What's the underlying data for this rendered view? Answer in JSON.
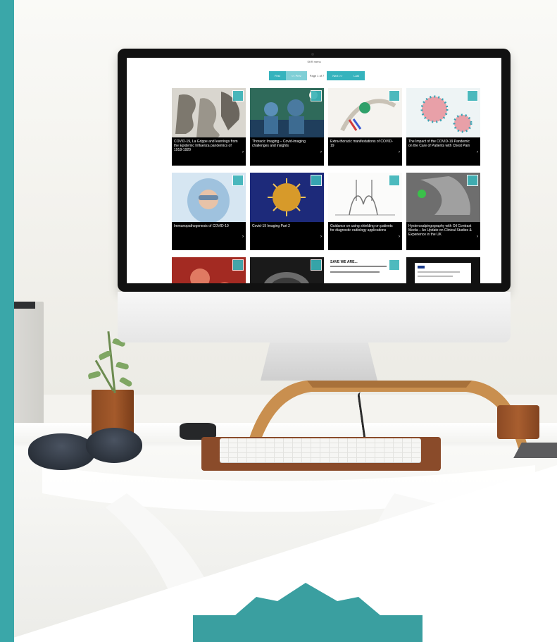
{
  "screen": {
    "title": "SKR menu",
    "pager": {
      "first": "First",
      "prev": "<< Prev",
      "info": "Page 1 of 7",
      "next": "Next >>",
      "last": "Last"
    },
    "cards": [
      {
        "title": "COVID-19, La Grippe and learnings from the Epidemic Influenza pandemics of 1918-1920",
        "kind": "engraving"
      },
      {
        "title": "Thoracic Imaging – Covid-imaging challenges and insights",
        "kind": "surgery"
      },
      {
        "title": "Extra-thoracic manifestations of COVID-19",
        "kind": "diagram"
      },
      {
        "title": "The Impact of the COVID-19 Pandemic on the Care of Patients with Chest Pain",
        "kind": "virus-pink"
      },
      {
        "title": "Immunopathogenesis of COVID-19",
        "kind": "ppe"
      },
      {
        "title": "Covid-19 Imaging Part 2",
        "kind": "virus-gold"
      },
      {
        "title": "Guidance on using shielding on patients for diagnostic radiology applications",
        "kind": "shielding"
      },
      {
        "title": "Hysterosalpingography with Oil Contrast Media – An Update on Clinical Studies & Experience in the UK",
        "kind": "xray"
      },
      {
        "title": "",
        "kind": "red"
      },
      {
        "title": "",
        "kind": "mri"
      },
      {
        "title": "SAVE WE ARE...",
        "kind": "text"
      },
      {
        "title": "",
        "kind": "doc"
      }
    ]
  },
  "colors": {
    "accent": "#35b3bd",
    "band": "#3aa7a9"
  }
}
